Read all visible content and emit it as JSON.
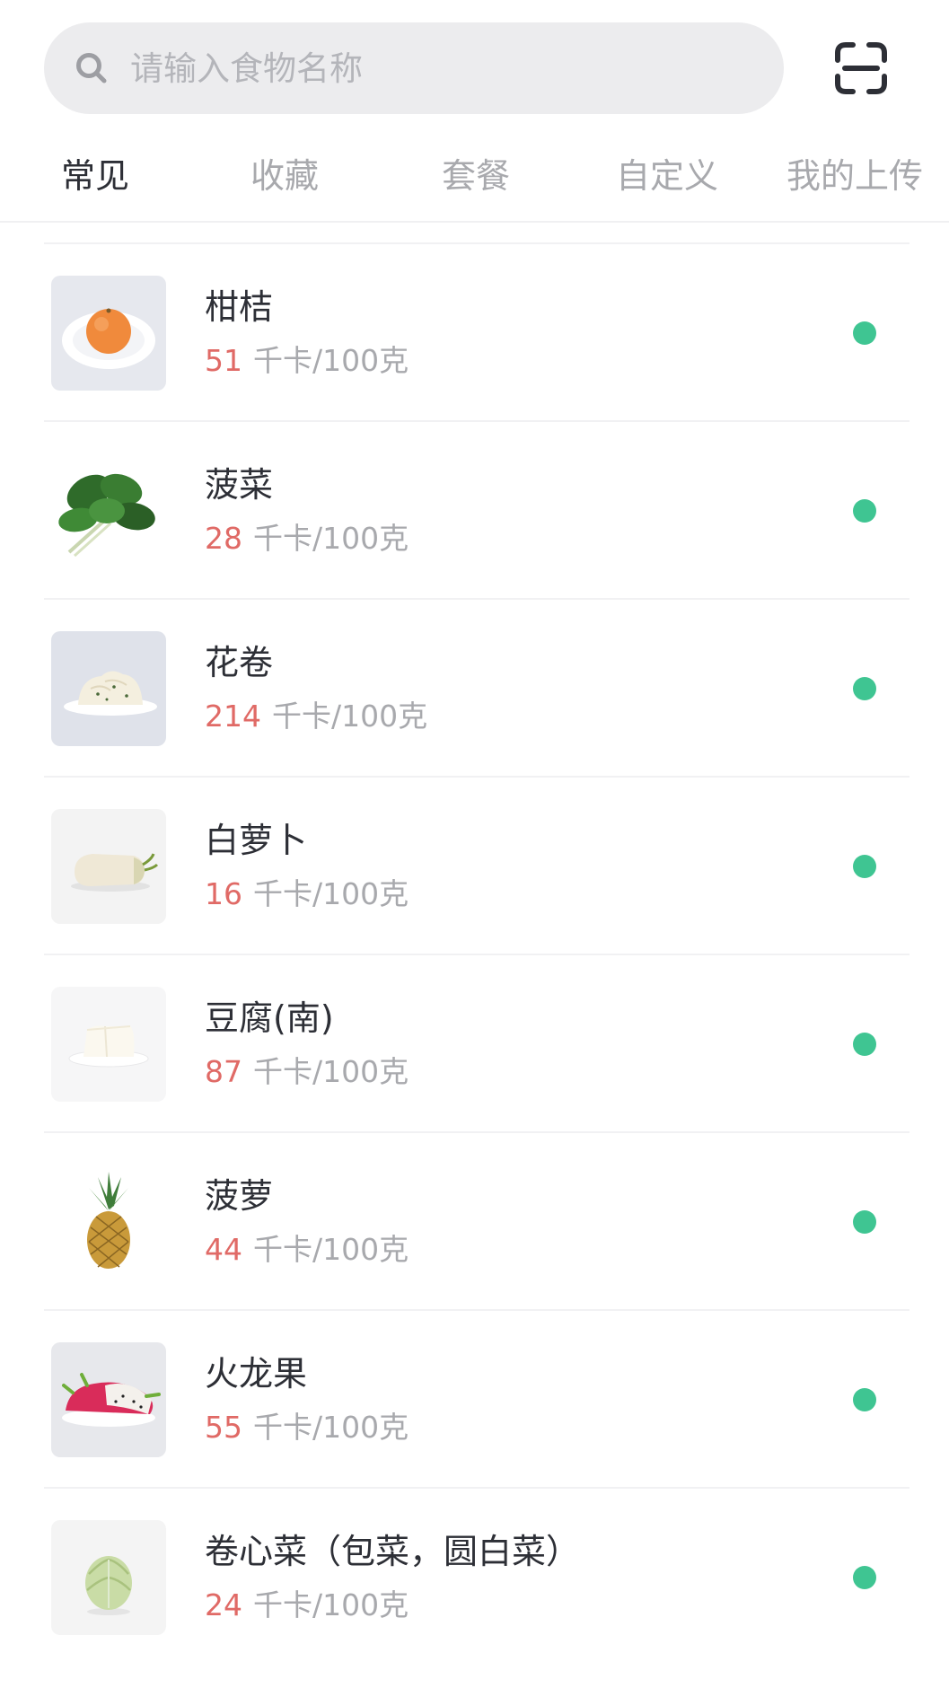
{
  "search": {
    "placeholder": "请输入食物名称",
    "value": ""
  },
  "icons": {
    "search": "search-icon",
    "scan": "scan-icon",
    "status": "status-dot"
  },
  "colors": {
    "kcal_value": "#e06a66",
    "status_dot": "#3fc592",
    "search_bg": "#ececee"
  },
  "tabs": [
    {
      "label": "常见",
      "active": true
    },
    {
      "label": "收藏",
      "active": false
    },
    {
      "label": "套餐",
      "active": false
    },
    {
      "label": "自定义",
      "active": false
    },
    {
      "label": "我的上传",
      "active": false
    }
  ],
  "foods": [
    {
      "name": "柑桔",
      "kcal": "51",
      "unit": "千卡/100克",
      "icon": "mandarin-orange-icon"
    },
    {
      "name": "菠菜",
      "kcal": "28",
      "unit": "千卡/100克",
      "icon": "spinach-icon"
    },
    {
      "name": "花卷",
      "kcal": "214",
      "unit": "千卡/100克",
      "icon": "steamed-roll-icon"
    },
    {
      "name": "白萝卜",
      "kcal": "16",
      "unit": "千卡/100克",
      "icon": "white-radish-icon"
    },
    {
      "name": "豆腐(南)",
      "kcal": "87",
      "unit": "千卡/100克",
      "icon": "tofu-icon"
    },
    {
      "name": "菠萝",
      "kcal": "44",
      "unit": "千卡/100克",
      "icon": "pineapple-icon"
    },
    {
      "name": "火龙果",
      "kcal": "55",
      "unit": "千卡/100克",
      "icon": "dragon-fruit-icon"
    },
    {
      "name": "卷心菜（包菜，圆白菜）",
      "kcal": "24",
      "unit": "千卡/100克",
      "icon": "cabbage-icon"
    }
  ]
}
